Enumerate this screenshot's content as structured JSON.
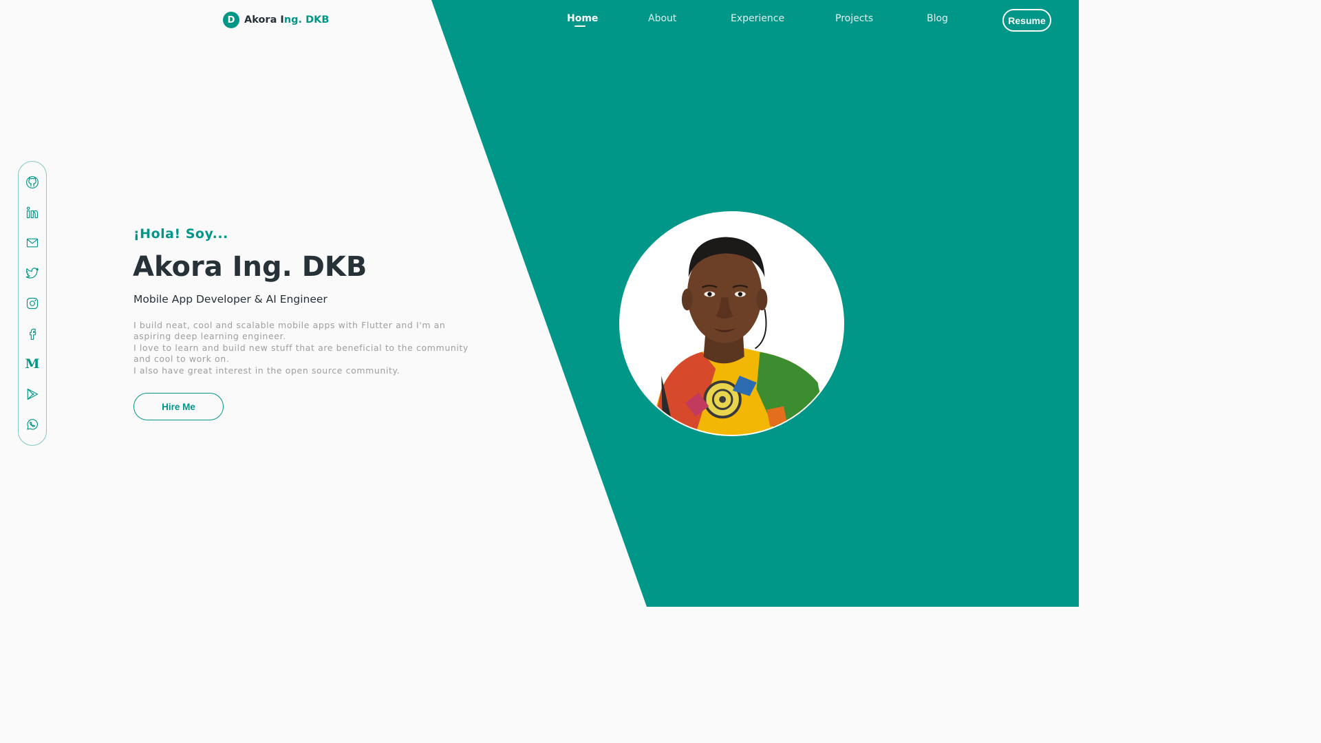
{
  "colors": {
    "accent": "#009688",
    "background": "#fafafa",
    "heading": "#263238",
    "muted_text": "#9e9e9e",
    "nav_text": "#e0f2f1",
    "white": "#ffffff"
  },
  "logo": {
    "badge_letter": "D",
    "name_part1": "Akora I",
    "name_part2": "ng. DKB"
  },
  "nav": {
    "active": "Home",
    "items": [
      "Home",
      "About",
      "Experience",
      "Projects",
      "Blog"
    ],
    "resume_label": "Resume"
  },
  "social": {
    "icons": [
      "github-icon",
      "linkedin-icon",
      "mail-icon",
      "twitter-icon",
      "instagram-icon",
      "facebook-icon",
      "medium-icon",
      "play-store-icon",
      "whatsapp-icon"
    ],
    "medium_glyph": "M"
  },
  "hero": {
    "greeting": "¡Hola! Soy...",
    "name": "Akora Ing. DKB",
    "role": "Mobile App Developer & AI Engineer",
    "description": [
      "I build neat, cool and scalable mobile apps with Flutter and I'm an aspiring deep learning engineer.",
      "I love to learn and build new stuff that are beneficial to the community and cool to work on.",
      "I also have great interest in the open source community."
    ],
    "cta_label": "Hire Me"
  },
  "portrait": {
    "icon": "profile-photo"
  }
}
